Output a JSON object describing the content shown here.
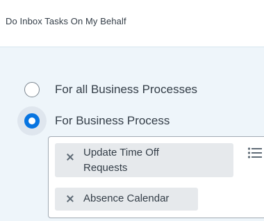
{
  "header": {
    "title": "Do Inbox Tasks On My Behalf"
  },
  "options": {
    "all_label": "For all Business Processes",
    "specific_label": "For Business Process",
    "selected": "specific"
  },
  "selected_processes": [
    {
      "line1": "Update Time Off",
      "line2": "Requests"
    },
    {
      "line1": "Absence Calendar"
    }
  ],
  "icons": {
    "remove": "close-icon",
    "prompt": "list-icon"
  },
  "colors": {
    "accent": "#0875e1",
    "panel_bg": "#eef5fa",
    "pill_bg": "#e6e9ec",
    "text": "#333d47"
  }
}
